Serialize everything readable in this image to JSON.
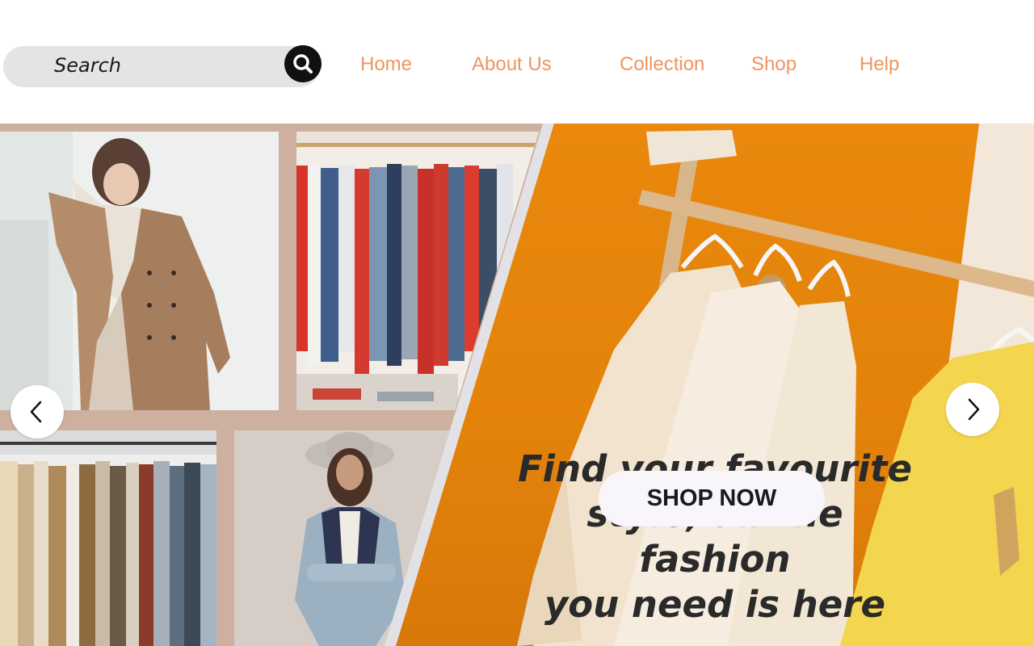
{
  "search": {
    "placeholder": "Search"
  },
  "nav": {
    "items": [
      {
        "label": "Home"
      },
      {
        "label": "About Us"
      },
      {
        "label": "Collection"
      },
      {
        "label": "Shop"
      },
      {
        "label": "Help"
      }
    ]
  },
  "hero": {
    "headline_line1": "Find your favourite",
    "headline_line2": "style, all the fashion",
    "headline_line3": "you need is here",
    "cta_label": "SHOP NOW"
  },
  "colors": {
    "accent": "#f0955e",
    "hero_orange": "#e3820a",
    "collage_bg": "#cdb0a0"
  },
  "icons": {
    "search": "search-icon",
    "prev": "chevron-left-icon",
    "next": "chevron-right-icon"
  }
}
